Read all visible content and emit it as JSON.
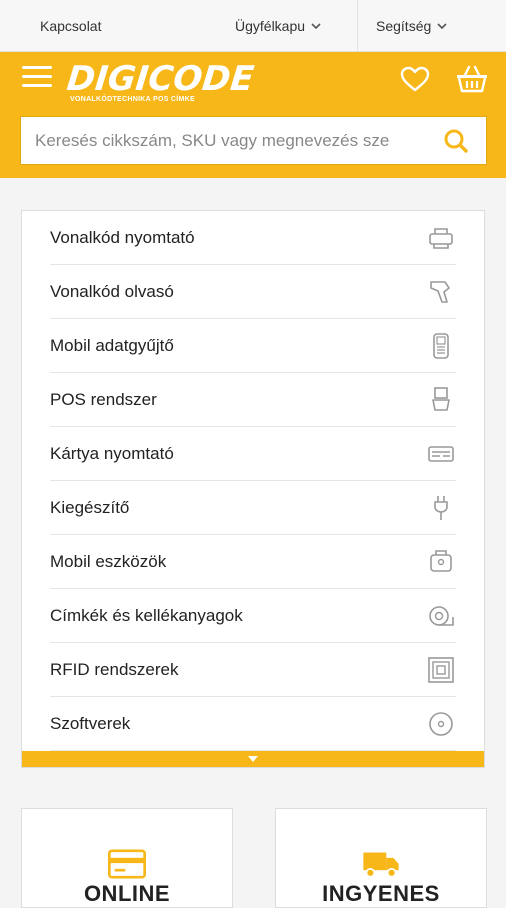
{
  "topbar": {
    "contact": "Kapcsolat",
    "client_portal": "Ügyfélkapu",
    "help": "Segítség"
  },
  "header": {
    "logo": "DIGICODE",
    "logo_sub": "VONALKÓDTECHNIKA POS CÍMKE",
    "accent_color": "#f7b718"
  },
  "search": {
    "placeholder": "Keresés cikkszám, SKU vagy megnevezés sze"
  },
  "menu": {
    "items": [
      {
        "label": "Vonalkód nyomtató",
        "icon": "printer-icon"
      },
      {
        "label": "Vonalkód olvasó",
        "icon": "scanner-icon"
      },
      {
        "label": "Mobil adatgyűjtő",
        "icon": "handheld-icon"
      },
      {
        "label": "POS rendszer",
        "icon": "pos-icon"
      },
      {
        "label": "Kártya nyomtató",
        "icon": "card-printer-icon"
      },
      {
        "label": "Kiegészítő",
        "icon": "plug-icon"
      },
      {
        "label": "Mobil eszközök",
        "icon": "mobile-printer-icon"
      },
      {
        "label": "Címkék és kellékanyagok",
        "icon": "label-roll-icon"
      },
      {
        "label": "RFID rendszerek",
        "icon": "rfid-icon"
      },
      {
        "label": "Szoftverek",
        "icon": "disc-icon"
      }
    ]
  },
  "cards": {
    "left_title": "ONLINE",
    "right_title": "INGYENES"
  }
}
